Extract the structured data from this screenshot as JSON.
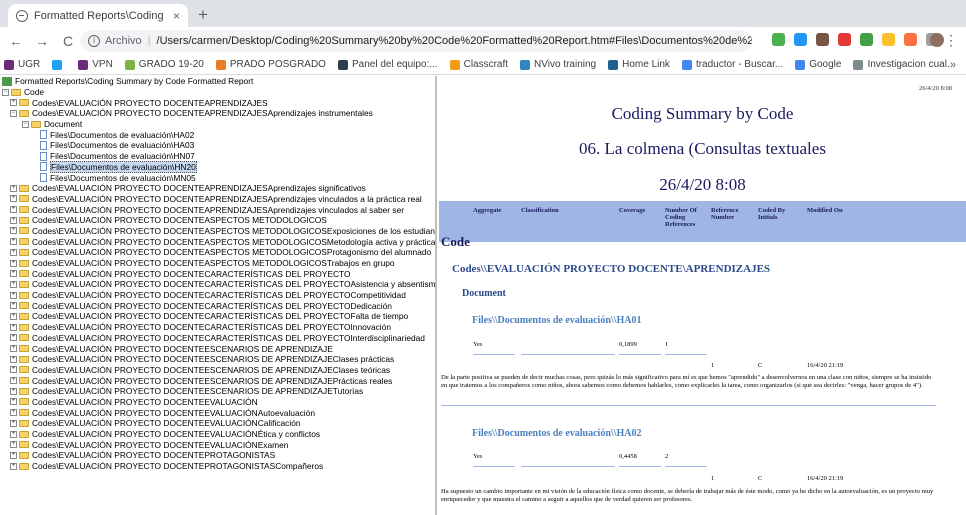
{
  "browser": {
    "tab_title": "Formatted Reports\\Coding Su",
    "tab_close": "×",
    "new_tab": "+",
    "nav_back": "←",
    "nav_forward": "→",
    "nav_reload": "C",
    "address_scheme": "Archivo",
    "address_url": "/Users/carmen/Desktop/Coding%20Summary%20by%20Code%20Formatted%20Report.htm#Files\\Documentos%20de%20eva...",
    "bookmark_star": "☆",
    "menu_dots": "⋮"
  },
  "bookmarks": [
    {
      "label": "UGR",
      "icon": "ugr-icon",
      "color": "#6b2a7a"
    },
    {
      "label": "",
      "icon": "twitter-icon",
      "color": "#1da1f2"
    },
    {
      "label": "VPN",
      "icon": "vpn-icon",
      "color": "#6b2a7a"
    },
    {
      "label": "GRADO 19-20",
      "icon": "grado-icon",
      "color": "#7cb342"
    },
    {
      "label": "PRADO POSGRADO",
      "icon": "prado-icon",
      "color": "#e67e22"
    },
    {
      "label": "Panel del equipo:...",
      "icon": "panel-icon",
      "color": "#2c3e50"
    },
    {
      "label": "Classcraft",
      "icon": "classcraft-icon",
      "color": "#f39c12"
    },
    {
      "label": "NVivo training",
      "icon": "nvivo-icon",
      "color": "#2e86c1"
    },
    {
      "label": "Home Link",
      "icon": "homelink-icon",
      "color": "#1f618d"
    },
    {
      "label": "traductor - Buscar...",
      "icon": "google-icon",
      "color": "#4285f4"
    },
    {
      "label": "Google",
      "icon": "google-icon",
      "color": "#4285f4"
    },
    {
      "label": "Investigacion cual...",
      "icon": "investigacion-icon",
      "color": "#7f8c8d"
    }
  ],
  "bookmarks_more": "»",
  "tree": {
    "root": "Formatted Reports\\Coding Summary by Code Formatted Report",
    "code": "Code",
    "items": [
      {
        "label": "Codes\\EVALUACIÓN PROYECTO DOCENTEAPRENDIZAJES",
        "level": 2,
        "expand": "+",
        "icon": "folder"
      },
      {
        "label": "Codes\\EVALUACIÓN PROYECTO DOCENTEAPRENDIZAJESAprendizajes instrumentales",
        "level": 2,
        "expand": "−",
        "icon": "folder"
      },
      {
        "label": "Document",
        "level": 3,
        "expand": "−",
        "icon": "folder"
      },
      {
        "label": "Files\\Documentos de evaluación\\HA02",
        "level": 4,
        "expand": "",
        "icon": "doc"
      },
      {
        "label": "Files\\Documentos de evaluación\\HA03",
        "level": 4,
        "expand": "",
        "icon": "doc"
      },
      {
        "label": "Files\\Documentos de evaluación\\HN07",
        "level": 4,
        "expand": "",
        "icon": "doc"
      },
      {
        "label": "Files\\Documentos de evaluación\\HN20",
        "level": 4,
        "expand": "",
        "icon": "doc",
        "selected": true
      },
      {
        "label": "Files\\Documentos de evaluación\\MN05",
        "level": 4,
        "expand": "",
        "icon": "doc"
      },
      {
        "label": "Codes\\EVALUACIÓN PROYECTO DOCENTEAPRENDIZAJESAprendizajes significativos",
        "level": 2,
        "expand": "+",
        "icon": "folder"
      },
      {
        "label": "Codes\\EVALUACIÓN PROYECTO DOCENTEAPRENDIZAJESAprendizajes vinculados a la práctica real",
        "level": 2,
        "expand": "+",
        "icon": "folder"
      },
      {
        "label": "Codes\\EVALUACIÓN PROYECTO DOCENTEAPRENDIZAJESAprendizajes vinculados al saber ser",
        "level": 2,
        "expand": "+",
        "icon": "folder"
      },
      {
        "label": "Codes\\EVALUACIÓN PROYECTO DOCENTEASPECTOS METODOLOGICOS",
        "level": 2,
        "expand": "+",
        "icon": "folder"
      },
      {
        "label": "Codes\\EVALUACIÓN PROYECTO DOCENTEASPECTOS METODOLOGICOSExposiciones de los estudiantes",
        "level": 2,
        "expand": "+",
        "icon": "folder"
      },
      {
        "label": "Codes\\EVALUACIÓN PROYECTO DOCENTEASPECTOS METODOLOGICOSMetodología activa y práctica",
        "level": 2,
        "expand": "+",
        "icon": "folder"
      },
      {
        "label": "Codes\\EVALUACIÓN PROYECTO DOCENTEASPECTOS METODOLOGICOSProtagonismo del alumnado",
        "level": 2,
        "expand": "+",
        "icon": "folder"
      },
      {
        "label": "Codes\\EVALUACIÓN PROYECTO DOCENTEASPECTOS METODOLOGICOSTrabajos en grupo",
        "level": 2,
        "expand": "+",
        "icon": "folder"
      },
      {
        "label": "Codes\\EVALUACIÓN PROYECTO DOCENTECARACTERÍSTICAS DEL PROYECTO",
        "level": 2,
        "expand": "+",
        "icon": "folder"
      },
      {
        "label": "Codes\\EVALUACIÓN PROYECTO DOCENTECARACTERÍSTICAS DEL PROYECTOAsistencia y absentismo",
        "level": 2,
        "expand": "+",
        "icon": "folder"
      },
      {
        "label": "Codes\\EVALUACIÓN PROYECTO DOCENTECARACTERÍSTICAS DEL PROYECTOCompetitividad",
        "level": 2,
        "expand": "+",
        "icon": "folder"
      },
      {
        "label": "Codes\\EVALUACIÓN PROYECTO DOCENTECARACTERÍSTICAS DEL PROYECTODedicación",
        "level": 2,
        "expand": "+",
        "icon": "folder"
      },
      {
        "label": "Codes\\EVALUACIÓN PROYECTO DOCENTECARACTERÍSTICAS DEL PROYECTOFalta de tiempo",
        "level": 2,
        "expand": "+",
        "icon": "folder"
      },
      {
        "label": "Codes\\EVALUACIÓN PROYECTO DOCENTECARACTERÍSTICAS DEL PROYECTOInnovación",
        "level": 2,
        "expand": "+",
        "icon": "folder"
      },
      {
        "label": "Codes\\EVALUACIÓN PROYECTO DOCENTECARACTERÍSTICAS DEL PROYECTOInterdisciplinariedad",
        "level": 2,
        "expand": "+",
        "icon": "folder"
      },
      {
        "label": "Codes\\EVALUACIÓN PROYECTO DOCENTEESCENARIOS DE APRENDIZAJE",
        "level": 2,
        "expand": "+",
        "icon": "folder"
      },
      {
        "label": "Codes\\EVALUACIÓN PROYECTO DOCENTEESCENARIOS DE APRENDIZAJEClases prácticas",
        "level": 2,
        "expand": "+",
        "icon": "folder"
      },
      {
        "label": "Codes\\EVALUACIÓN PROYECTO DOCENTEESCENARIOS DE APRENDIZAJEClases teóricas",
        "level": 2,
        "expand": "+",
        "icon": "folder"
      },
      {
        "label": "Codes\\EVALUACIÓN PROYECTO DOCENTEESCENARIOS DE APRENDIZAJEPrácticas reales",
        "level": 2,
        "expand": "+",
        "icon": "folder"
      },
      {
        "label": "Codes\\EVALUACIÓN PROYECTO DOCENTEESCENARIOS DE APRENDIZAJETutorías",
        "level": 2,
        "expand": "+",
        "icon": "folder"
      },
      {
        "label": "Codes\\EVALUACIÓN PROYECTO DOCENTEEVALUACIÓN",
        "level": 2,
        "expand": "+",
        "icon": "folder"
      },
      {
        "label": "Codes\\EVALUACIÓN PROYECTO DOCENTEEVALUACIÓNAutoevaluación",
        "level": 2,
        "expand": "+",
        "icon": "folder"
      },
      {
        "label": "Codes\\EVALUACIÓN PROYECTO DOCENTEEVALUACIÓNCalificación",
        "level": 2,
        "expand": "+",
        "icon": "folder"
      },
      {
        "label": "Codes\\EVALUACIÓN PROYECTO DOCENTEEVALUACIÓNÉtica y conflictos",
        "level": 2,
        "expand": "+",
        "icon": "folder"
      },
      {
        "label": "Codes\\EVALUACIÓN PROYECTO DOCENTEEVALUACIÓNExamen",
        "level": 2,
        "expand": "+",
        "icon": "folder"
      },
      {
        "label": "Codes\\EVALUACIÓN PROYECTO DOCENTEPROTAGONISTAS",
        "level": 2,
        "expand": "+",
        "icon": "folder"
      },
      {
        "label": "Codes\\EVALUACIÓN PROYECTO DOCENTEPROTAGONISTASCompañeros",
        "level": 2,
        "expand": "+",
        "icon": "folder"
      }
    ]
  },
  "report": {
    "date_top": "26/4/20 8:08",
    "title": "Coding Summary by Code",
    "subtitle": "06. La colmena (Consultas textuales",
    "date": "26/4/20 8:08",
    "headers": {
      "aggregate": "Aggregate",
      "classification": "Classification",
      "coverage": "Coverage",
      "number_of_coding_references": "Number Of Coding References",
      "reference_number": "Reference Number",
      "coded_by_initials": "Coded By Initials",
      "modified_on": "Modified On"
    },
    "code_heading": "Code",
    "code_path": "Codes\\\\EVALUACIÓN PROYECTO DOCENTE\\APRENDIZAJES",
    "document_heading": "Document",
    "entries": [
      {
        "file": "Files\\\\Documentos de evaluación\\\\HA01",
        "aggregate": "Yes",
        "coverage": "0,1899",
        "count": "1",
        "ref_number": "1",
        "coded_by": "C",
        "modified_on": "16/4/20 21:19",
        "text": "De la parte positiva se pueden de decir muchas cosas, pero quizás lo más significativo para mí es que hemos \"aprendido\" a desenvolvernos en una clase con niños, siempre se ha insistido en que tratemos a los compañeros como niños, ahora sabemos como debemos hablarles, como explicarles la tarea, como organizarlos (si que sea decirles: \"venga, hacer grupos de 4\")."
      },
      {
        "file": "Files\\\\Documentos de evaluación\\\\HA02",
        "aggregate": "Yes",
        "coverage": "0,4458",
        "count": "2",
        "ref_number": "1",
        "coded_by": "C",
        "modified_on": "16/4/20 21:19",
        "text": "Ha supuesto un cambio importante en mi visión de la educación física como docente, se debería de trabajar más de éste modo, como ya he dicho en la autoevaluación, es un proyecto muy enriquecedor y que muestra el camino a seguir a aquellos que de verdad quieren ser profesores."
      }
    ]
  },
  "colors": {
    "header_band": "#9fb5e3",
    "title_text": "#1a1a5e",
    "heading_blue": "#2c4a8a",
    "file_blue": "#4a7fc0"
  }
}
